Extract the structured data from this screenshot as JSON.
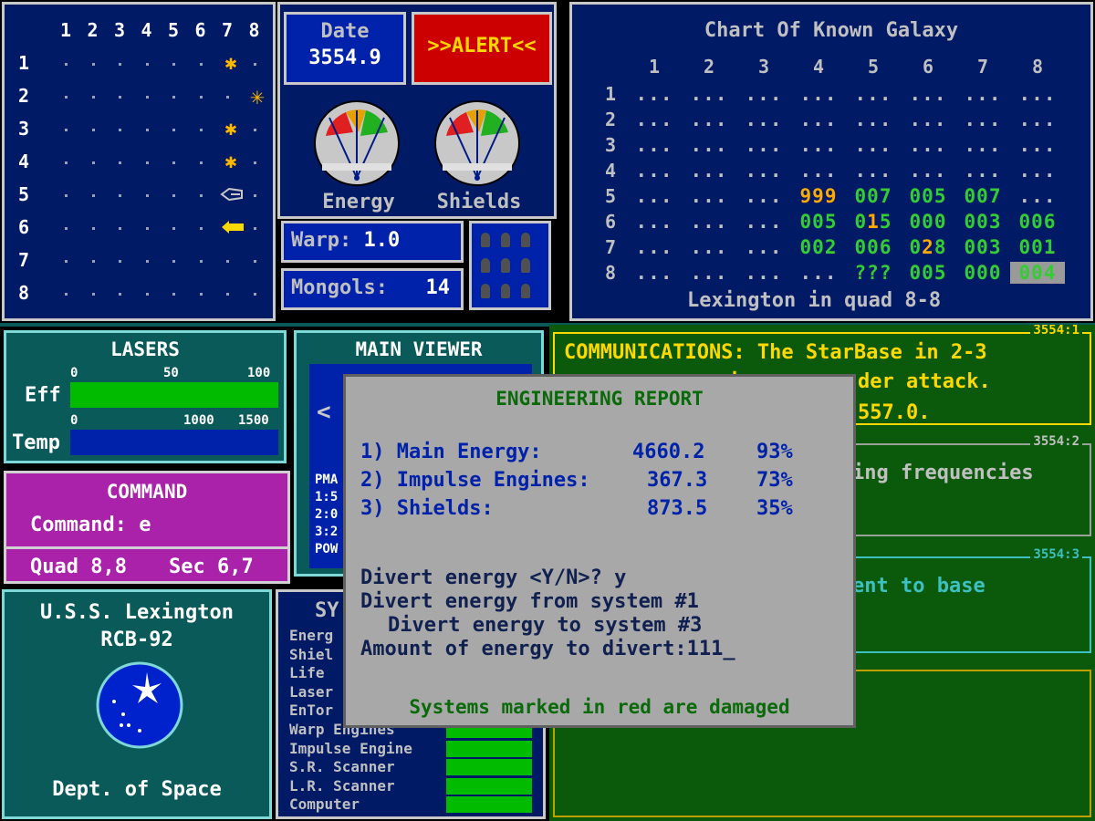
{
  "sector": {
    "cols": [
      "1",
      "2",
      "3",
      "4",
      "5",
      "6",
      "7",
      "8"
    ],
    "rows": [
      "1",
      "2",
      "3",
      "4",
      "5",
      "6",
      "7",
      "8"
    ]
  },
  "status": {
    "date_label": "Date",
    "date_value": "3554.9",
    "alert": ">>ALERT<<",
    "energy_label": "Energy",
    "shields_label": "Shields",
    "warp_label": "Warp:",
    "warp_value": "1.0",
    "mongols_label": "Mongols:",
    "mongols_value": "14"
  },
  "galaxy": {
    "title": "Chart Of Known Galaxy",
    "cols": [
      "1",
      "2",
      "3",
      "4",
      "5",
      "6",
      "7",
      "8"
    ],
    "rows": [
      "1",
      "2",
      "3",
      "4",
      "5",
      "6",
      "7",
      "8"
    ],
    "cells": [
      [
        "...",
        "...",
        "...",
        "...",
        "...",
        "...",
        "...",
        "..."
      ],
      [
        "...",
        "...",
        "...",
        "...",
        "...",
        "...",
        "...",
        "..."
      ],
      [
        "...",
        "...",
        "...",
        "...",
        "...",
        "...",
        "...",
        "..."
      ],
      [
        "...",
        "...",
        "...",
        "...",
        "...",
        "...",
        "...",
        "..."
      ],
      [
        "...",
        "...",
        "...",
        "999",
        "007",
        "005",
        "007",
        "..."
      ],
      [
        "...",
        "...",
        "...",
        "005",
        "015",
        "000",
        "003",
        "006"
      ],
      [
        "...",
        "...",
        "...",
        "002",
        "006",
        "028",
        "003",
        "001"
      ],
      [
        "...",
        "...",
        "...",
        "...",
        "???",
        "005",
        "000",
        "004"
      ]
    ],
    "footer": "Lexington in quad 8-8"
  },
  "lasers": {
    "title": "LASERS",
    "eff_label": "Eff",
    "temp_label": "Temp",
    "eff_ticks": [
      "0",
      "50",
      "100"
    ],
    "temp_ticks": [
      "0",
      "1000",
      "1500"
    ],
    "eff_value": 100,
    "temp_value": 1500
  },
  "viewer": {
    "title": "MAIN VIEWER",
    "lines": [
      "PMA",
      "1:5",
      "2:0",
      "3:2",
      "POW"
    ]
  },
  "command": {
    "title": "COMMAND",
    "prompt": "Command: e",
    "quad": "Quad 8,8",
    "sec": "Sec 6,7"
  },
  "ship": {
    "name": "U.S.S. Lexington",
    "reg": "RCB-92",
    "dept": "Dept. of Space"
  },
  "systems": {
    "title": "SY",
    "rows": [
      "Energ",
      "Shiel",
      "Life",
      "Laser",
      "EnTor",
      "Warp Engines",
      "Impulse Engine",
      "S.R. Scanner",
      "L.R. Scanner",
      "Computer"
    ]
  },
  "comms": [
    {
      "tag": "3554:1",
      "line1": "COMMUNICATIONS: The StarBase in 2-3",
      "line2a": "is",
      "line2b": "der attack.",
      "line3": "557.0."
    },
    {
      "tag": "3554:2",
      "line1": "ing frequencies"
    },
    {
      "tag": "3554:3",
      "line1": "ent to base"
    }
  ],
  "dialog": {
    "title": "ENGINEERING REPORT",
    "items": [
      {
        "label": "1) Main Energy:",
        "value": "4660.2",
        "pct": "93%"
      },
      {
        "label": "2) Impulse Engines:",
        "value": "367.3",
        "pct": "73%"
      },
      {
        "label": "3) Shields:",
        "value": "873.5",
        "pct": "35%"
      }
    ],
    "q1": "Divert energy <Y/N>? y",
    "q2": "Divert energy from system #1",
    "q3": "Divert energy to system #3",
    "q4": "Amount of energy to divert:111_",
    "footer": "Systems marked in red are damaged"
  }
}
